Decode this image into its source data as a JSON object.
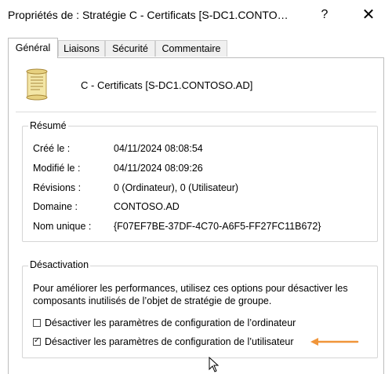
{
  "window": {
    "title": "Propriétés de : Stratégie C - Certificats [S-DC1.CONTO…",
    "help": "?",
    "close": "✕"
  },
  "tabs": [
    {
      "label": "Général",
      "active": true
    },
    {
      "label": "Liaisons",
      "active": false
    },
    {
      "label": "Sécurité",
      "active": false
    },
    {
      "label": "Commentaire",
      "active": false
    }
  ],
  "gpo": {
    "icon": "gpo-scroll-icon",
    "name": "C - Certificats [S-DC1.CONTOSO.AD]"
  },
  "summary": {
    "heading": "Résumé",
    "rows": [
      {
        "label": "Créé le :",
        "value": "04/11/2024 08:08:54"
      },
      {
        "label": "Modifié le :",
        "value": "04/11/2024 08:09:26"
      },
      {
        "label": "Révisions :",
        "value": "0 (Ordinateur), 0 (Utilisateur)"
      },
      {
        "label": "Domaine :",
        "value": "CONTOSO.AD"
      },
      {
        "label": "Nom unique :",
        "value": "{F07EF7BE-37DF-4C70-A6F5-FF27FC11B672}"
      }
    ]
  },
  "disable": {
    "heading": "Désactivation",
    "description": "Pour améliorer les performances, utilisez ces options pour désactiver les composants inutilisés de l’objet de stratégie de groupe.",
    "options": [
      {
        "label": "Désactiver les paramètres de configuration de l’ordinateur",
        "checked": false,
        "mark": ""
      },
      {
        "label": "Désactiver les paramètres de configuration de l’utilisateur",
        "checked": true,
        "mark": "✓"
      }
    ]
  },
  "colors": {
    "annotation_arrow": "#f0953a"
  }
}
